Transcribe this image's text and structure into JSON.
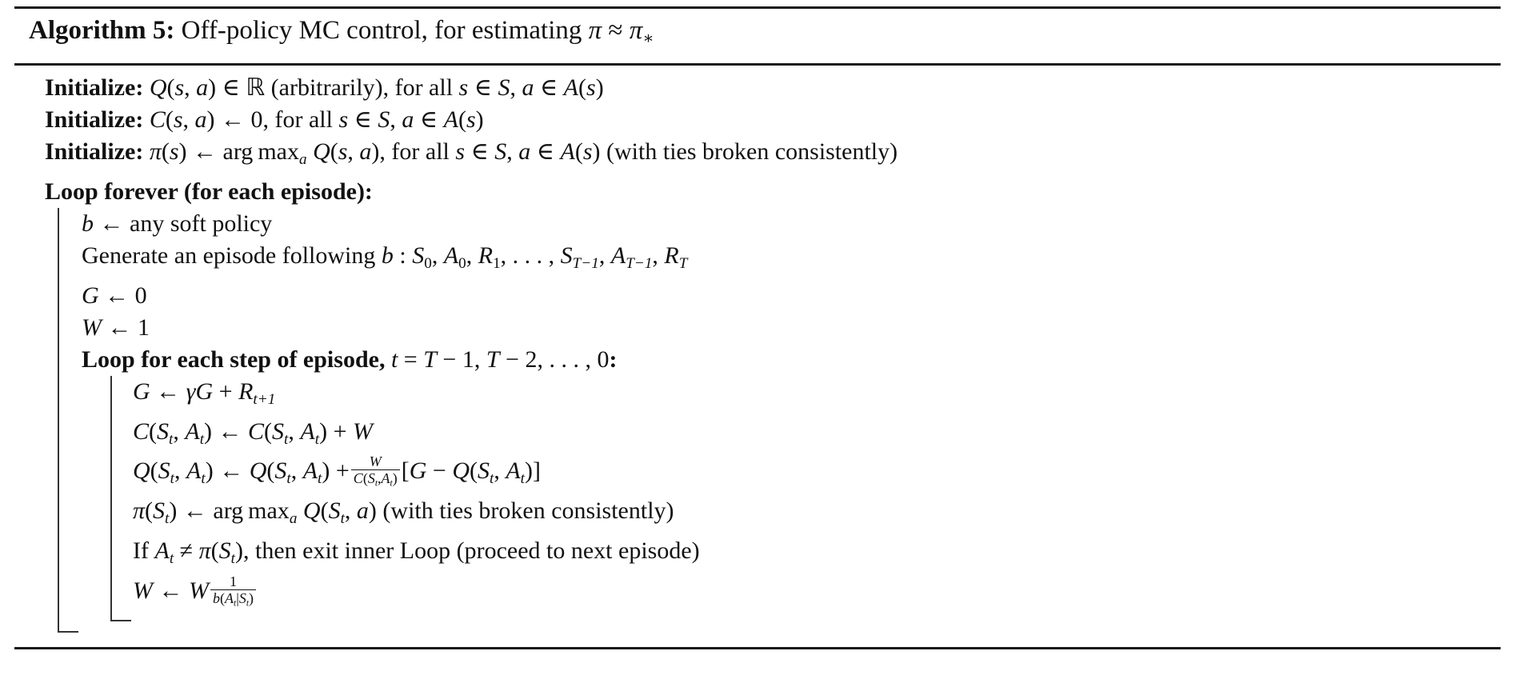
{
  "document": {
    "kind": "algorithm-pseudocode-box",
    "title": {
      "label": "Algorithm 5:",
      "text": "Off-policy MC control, for estimating ",
      "target": "π ≈ π∗"
    },
    "lines": {
      "init1_keyword": "Initialize:",
      "init1_body": "Q(s, a) ∈ ℝ (arbitrarily), for all s ∈ 𝒮, a ∈ 𝒜(s)",
      "init2_keyword": "Initialize:",
      "init2_body": "C(s, a) ← 0, for all s ∈ 𝒮, a ∈ 𝒜(s)",
      "init3_keyword": "Initialize:",
      "init3_body": "π(s) ← arg max_a Q(s, a), for all s ∈ 𝒮, a ∈ 𝒜(s) (with ties broken consistently)",
      "loop_forever": "Loop forever (for each episode):",
      "behavior_policy": "b ← any soft policy",
      "generate_episode": "Generate an episode following b : S0, A0, R1, . . . , S(T−1), A(T−1), RT",
      "g_init": "G ← 0",
      "w_init": "W ← 1",
      "inner_loop_header_bold": "Loop for each step of episode,",
      "inner_loop_header_math": "t = T − 1, T − 2, . . . , 0:",
      "g_update": "G ← γG + R(t+1)",
      "c_update": "C(St, At) ← C(St, At) + W",
      "q_update": "Q(St, At) ← Q(St, At) + W / C(St,At) [G − Q(St, At)]",
      "pi_update": "π(St) ← arg max_a Q(St, a) (with ties broken consistently)",
      "exit_condition": "If At ≠ π(St), then exit inner Loop (proceed to next episode)",
      "w_update": "W ← W · 1 / b(At|St)"
    },
    "tokens": {
      "arg": "arg",
      "max": "max",
      "sub_a": "a",
      "in": "∈",
      "leftarrow": "←",
      "approx": "≈",
      "neq": "≠",
      "minus": "−",
      "plus": "+",
      "equals": "=",
      "dots": ". . . ,",
      "comma": ",",
      "colon": ":",
      "pi": "π",
      "gamma": "γ",
      "star": "∗",
      "real_set": "ℝ",
      "state_set": "S",
      "action_set": "A",
      "for_all": "for all",
      "arbitrarily": "(arbitrarily),",
      "ties": "(with ties broken consistently)",
      "any_soft_policy": "any soft policy",
      "generate_prefix": "Generate an episode following",
      "if_word": "If",
      "then_exit": ", then exit inner Loop (proceed to next episode)",
      "zero": "0",
      "one": "1"
    },
    "colors": {
      "text": "#111111",
      "rule": "#1a1a1a",
      "bracket": "#333333",
      "background": "#ffffff"
    }
  }
}
